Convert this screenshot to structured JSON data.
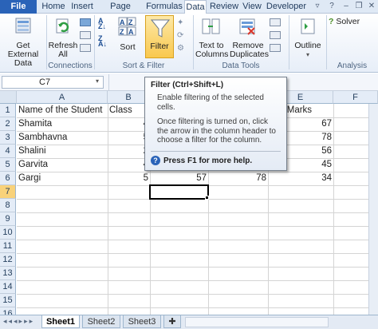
{
  "ribbon_tabs": [
    "File",
    "Home",
    "Insert",
    "Page Layout",
    "Formulas",
    "Data",
    "Review",
    "View",
    "Developer"
  ],
  "ribbon": {
    "get_external_data": "Get External Data",
    "refresh_all": "Refresh All",
    "group_connections": "Connections",
    "sort": "Sort",
    "filter": "Filter",
    "group_sort_filter": "Sort & Filter",
    "text_to_columns": "Text to Columns",
    "remove_duplicates": "Remove Duplicates",
    "group_data_tools": "Data Tools",
    "outline": "Outline",
    "solver": "Solver",
    "group_analysis": "Analysis"
  },
  "formula_bar": {
    "name_box": "C7"
  },
  "columns": [
    "A",
    "B",
    "C",
    "D",
    "E",
    "F"
  ],
  "rows": [
    "1",
    "2",
    "3",
    "4",
    "5",
    "6",
    "7",
    "8",
    "9",
    "10",
    "11",
    "12",
    "13",
    "14",
    "15",
    "16"
  ],
  "table": {
    "header": {
      "a": "Name of the Student",
      "b": "Class",
      "e": "nce Marks"
    },
    "data": [
      {
        "name": "Shamita",
        "b": "4",
        "e": "67"
      },
      {
        "name": "Sambhavna",
        "b": "5",
        "e": "78"
      },
      {
        "name": "Shalini",
        "b": "2",
        "e": "56"
      },
      {
        "name": "Garvita",
        "b": "4",
        "e": "45"
      },
      {
        "name": "Gargi",
        "b": "5",
        "c": "57",
        "d": "78",
        "e": "34"
      }
    ]
  },
  "tooltip": {
    "title": "Filter (Ctrl+Shift+L)",
    "line1": "Enable filtering of the selected cells.",
    "line2": "Once filtering is turned on, click the arrow in the column header to choose a filter for the column.",
    "help": "Press F1 for more help."
  },
  "sheets": [
    "Sheet1",
    "Sheet2",
    "Sheet3"
  ],
  "colors": {
    "file_tab": "#2a63b8",
    "filter_highlight": "#fbd66b",
    "header_bg": "#e4ecf7"
  }
}
